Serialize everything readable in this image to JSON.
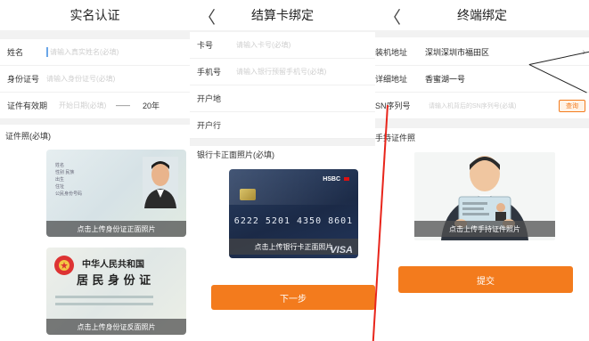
{
  "screen1": {
    "title": "实名认证",
    "name_label": "姓名",
    "name_placeholder": "请输入真实姓名(必填)",
    "id_label": "身份证号",
    "id_placeholder": "请输入身份证号(必填)",
    "validity_label": "证件有效期",
    "validity_placeholder": "开始日期(必填)",
    "validity_sep": "——",
    "validity_end": "20年",
    "photo_title": "证件照(必填)",
    "front_caption": "点击上传身份证正面照片",
    "back_caption": "点击上传身份证反面照片",
    "front_card_lines": [
      "姓名",
      "性别 民族",
      "出生",
      "住址",
      "公民身份号码"
    ],
    "back_card_title_1": "中华人民共和国",
    "back_card_title_2": "居 民 身 份 证"
  },
  "screen2": {
    "title": "结算卡绑定",
    "card_label": "卡号",
    "card_placeholder": "请输入卡号(必填)",
    "phone_label": "手机号",
    "phone_placeholder": "请输入银行预留手机号(必填)",
    "region_label": "开户地",
    "bank_label": "开户行",
    "photo_title": "银行卡正面照片(必填)",
    "bank_brand": "HSBC",
    "card_number": "6222 5201 4350 8601",
    "card_caption": "点击上传银行卡正面照片",
    "card_network": "VISA",
    "next_button": "下一步"
  },
  "screen3": {
    "title": "终端绑定",
    "address_label": "装机地址",
    "address_value": "深圳深圳市福田区",
    "detail_label": "详细地址",
    "detail_value": "香蜜湖一号",
    "sn_label": "SN序列号",
    "sn_placeholder": "请输入机背后的SN序列号(必填)",
    "query_button": "查询",
    "photo_title": "手持证件照",
    "photo_caption": "点击上传手持证件照片",
    "submit_button": "提交"
  },
  "colors": {
    "accent": "#f37b1d",
    "annotation_red": "#e8251b"
  }
}
